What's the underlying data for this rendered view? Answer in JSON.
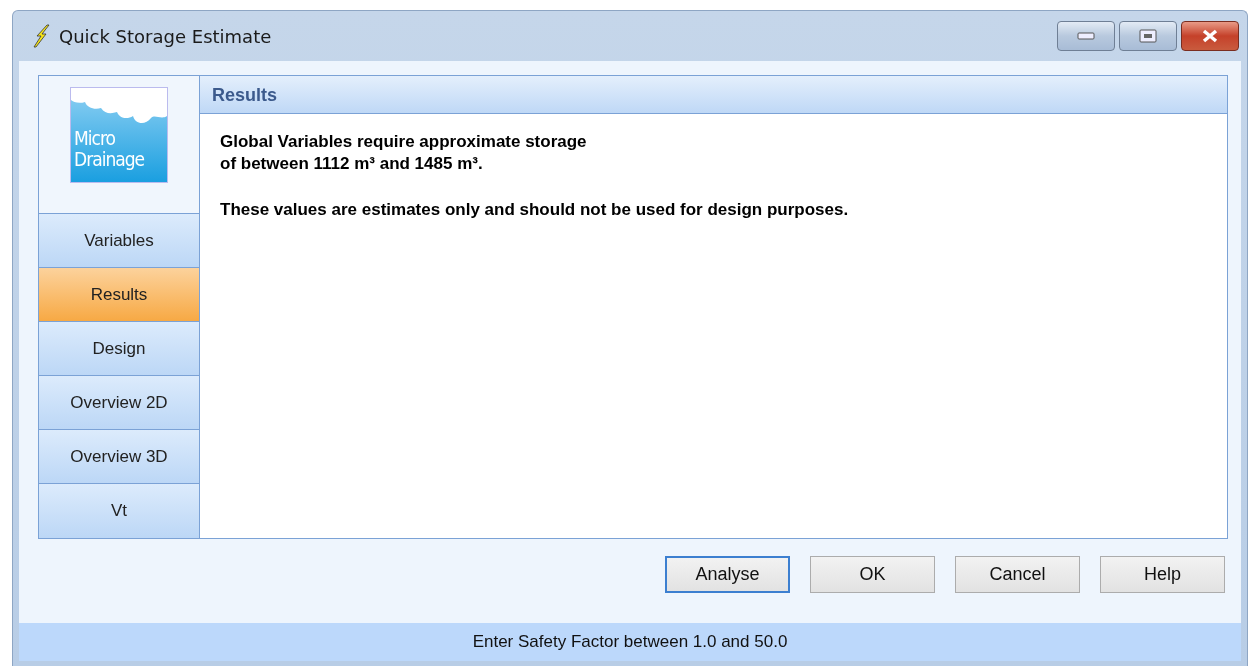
{
  "window": {
    "title": "Quick Storage Estimate"
  },
  "logo": {
    "lines": [
      "Micro",
      "Drainage"
    ]
  },
  "nav": [
    {
      "label": "Variables",
      "selected": false
    },
    {
      "label": "Results",
      "selected": true
    },
    {
      "label": "Design",
      "selected": false
    },
    {
      "label": "Overview 2D",
      "selected": false
    },
    {
      "label": "Overview 3D",
      "selected": false
    },
    {
      "label": "Vt",
      "selected": false
    }
  ],
  "panel": {
    "title": "Results",
    "paragraphs": [
      "Global Variables require approximate storage\nof between 1112 m³ and 1485 m³.",
      "These values are estimates only and should not be used for design purposes."
    ]
  },
  "buttons": [
    {
      "label": "Analyse",
      "focused": true
    },
    {
      "label": "OK",
      "focused": false
    },
    {
      "label": "Cancel",
      "focused": false
    },
    {
      "label": "Help",
      "focused": false
    }
  ],
  "status_bar": "Enter Safety Factor between 1.0 and 50.0"
}
